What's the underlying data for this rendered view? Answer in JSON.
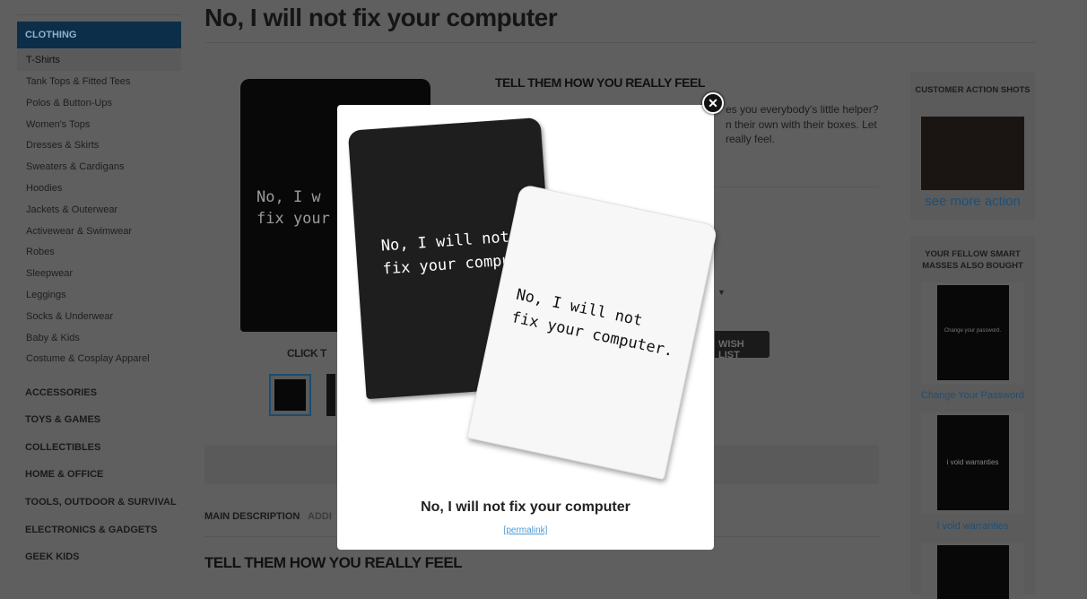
{
  "page": {
    "title": "No, I will not fix your computer"
  },
  "sidebar": {
    "section": "CLOTHING",
    "items": [
      "T-Shirts",
      "Tank Tops & Fitted Tees",
      "Polos & Button-Ups",
      "Women's Tops",
      "Dresses & Skirts",
      "Sweaters & Cardigans",
      "Hoodies",
      "Jackets & Outerwear",
      "Activewear & Swimwear",
      "Robes",
      "Sleepwear",
      "Leggings",
      "Socks & Underwear",
      "Baby & Kids",
      "Costume & Cosplay Apparel"
    ],
    "categories": [
      "ACCESSORIES",
      "TOYS & GAMES",
      "COLLECTIBLES",
      "HOME & OFFICE",
      "TOOLS, OUTDOOR & SURVIVAL",
      "ELECTRONICS & GADGETS",
      "GEEK KIDS"
    ]
  },
  "product": {
    "shirt_text": "No, I w\nfix your",
    "click_hint": "CLICK T",
    "heading": "TELL THEM HOW YOU REALLY FEEL",
    "desc_lines": [
      "es you everybody's little helper?",
      "n their own with their boxes. Let",
      " really feel."
    ],
    "wishlist_label": "WISH LIST"
  },
  "tabs": [
    "MAIN DESCRIPTION",
    "ADDI"
  ],
  "bottom_heading": "TELL THEM HOW YOU REALLY FEEL",
  "right": {
    "action_title": "CUSTOMER ACTION SHOTS",
    "see_more": "see more action",
    "also_title": "YOUR FELLOW SMART MASSES ALSO BOUGHT",
    "products": [
      {
        "name": "Change Your Password",
        "shirt_text": "Change your password."
      },
      {
        "name": "I void warranties",
        "shirt_text": "i void warranties"
      }
    ]
  },
  "modal": {
    "black_tee_text": "No, I will not\nfix your compu",
    "white_tee_text": "No, I will not\nfix your computer.",
    "caption": "No, I will not fix your computer",
    "permalink": "[permalink]",
    "close_icon": "close-icon"
  },
  "colors": {
    "accent": "#1b6fa6",
    "link": "#4a9bd6"
  }
}
